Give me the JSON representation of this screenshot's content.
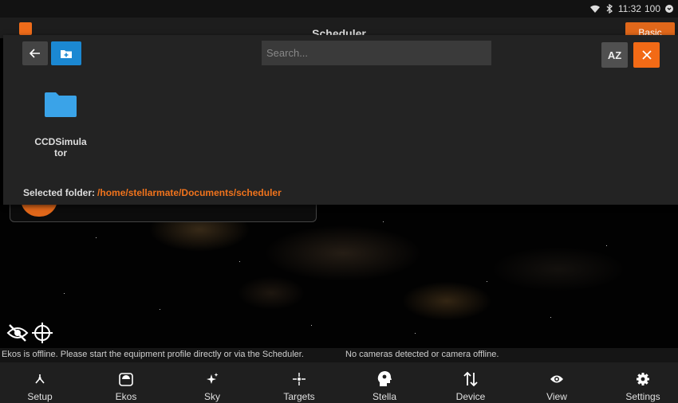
{
  "status_bar": {
    "time": "11:32",
    "battery": "100"
  },
  "app": {
    "title": "Scheduler",
    "mode_button": "Basic"
  },
  "dialog": {
    "search_placeholder": "Search...",
    "sort_label": "AZ",
    "folders": [
      {
        "name": "CCDSimulator"
      }
    ],
    "selected_folder_label": "Selected folder:",
    "selected_folder_path": "/home/stellarmate/Documents/scheduler"
  },
  "messages": {
    "ekos": "Ekos is offline. Please start the equipment profile directly or via the Scheduler.",
    "camera": "No cameras detected or camera offline."
  },
  "bottom_nav": {
    "items": [
      {
        "label": "Setup",
        "icon": "setup-icon"
      },
      {
        "label": "Ekos",
        "icon": "ekos-icon"
      },
      {
        "label": "Sky",
        "icon": "sky-icon"
      },
      {
        "label": "Targets",
        "icon": "targets-icon"
      },
      {
        "label": "Stella",
        "icon": "stella-icon"
      },
      {
        "label": "Device",
        "icon": "device-icon"
      },
      {
        "label": "View",
        "icon": "view-icon"
      },
      {
        "label": "Settings",
        "icon": "settings-icon"
      }
    ]
  },
  "colors": {
    "accent": "#f26a16",
    "folder": "#3aa3e8",
    "new_folder_button": "#1b88d2"
  }
}
